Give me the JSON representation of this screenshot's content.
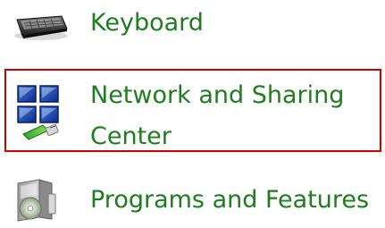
{
  "control_panel": {
    "items": [
      {
        "label": "Keyboard",
        "icon": "keyboard-icon"
      },
      {
        "label_lines": [
          "Network and Sharing",
          "Center"
        ],
        "icon": "network-and-sharing-center-icon",
        "highlighted": true,
        "highlight_color": "#d40000"
      },
      {
        "label": "Programs and Features",
        "icon": "programs-and-features-icon"
      }
    ]
  },
  "colors": {
    "link_text": "#1e7d1e",
    "background": "#ffffff"
  }
}
